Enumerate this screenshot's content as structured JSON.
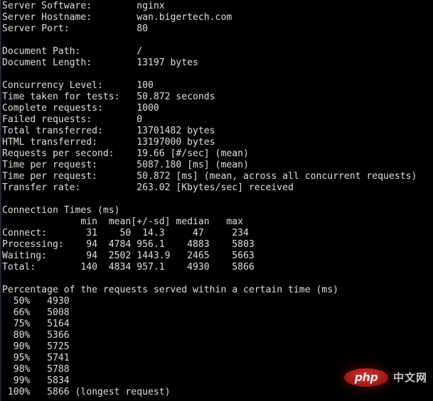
{
  "terminal": {
    "theme": {
      "background": "#000000",
      "foreground": "#d4d4d4",
      "border": "#1e2835"
    },
    "columns": 76,
    "rows": 35
  },
  "report": {
    "server": {
      "software_label": "Server Software:",
      "software_value": "nginx",
      "hostname_label": "Server Hostname:",
      "hostname_value": "wan.bigertech.com",
      "port_label": "Server Port:",
      "port_value": "80"
    },
    "document": {
      "path_label": "Document Path:",
      "path_value": "/",
      "length_label": "Document Length:",
      "length_value": "13197 bytes"
    },
    "summary": [
      {
        "label": "Concurrency Level:",
        "value": "100"
      },
      {
        "label": "Time taken for tests:",
        "value": "50.872 seconds"
      },
      {
        "label": "Complete requests:",
        "value": "1000"
      },
      {
        "label": "Failed requests:",
        "value": "0"
      },
      {
        "label": "Total transferred:",
        "value": "13701482 bytes"
      },
      {
        "label": "HTML transferred:",
        "value": "13197000 bytes"
      },
      {
        "label": "Requests per second:",
        "value": "19.66 [#/sec] (mean)"
      },
      {
        "label": "Time per request:",
        "value": "5087.180 [ms] (mean)"
      },
      {
        "label": "Time per request:",
        "value": "50.872 [ms] (mean, across all concurrent requests)"
      },
      {
        "label": "Transfer rate:",
        "value": "263.02 [Kbytes/sec] received"
      }
    ],
    "connection_times": {
      "heading": "Connection Times (ms)",
      "columns": [
        "min",
        "mean[+/-sd]",
        "median",
        "max"
      ],
      "rows": [
        {
          "label": "Connect:",
          "min": "31",
          "mean": "50",
          "sd": "14.3",
          "median": "47",
          "max": "234"
        },
        {
          "label": "Processing:",
          "min": "94",
          "mean": "4784",
          "sd": "956.1",
          "median": "4883",
          "max": "5803"
        },
        {
          "label": "Waiting:",
          "min": "94",
          "mean": "2502",
          "sd": "1443.9",
          "median": "2465",
          "max": "5663"
        },
        {
          "label": "Total:",
          "min": "140",
          "mean": "4834",
          "sd": "957.1",
          "median": "4930",
          "max": "5866"
        }
      ]
    },
    "percentiles": {
      "heading": "Percentage of the requests served within a certain time (ms)",
      "rows": [
        {
          "percent": "50%",
          "value": "4930",
          "note": ""
        },
        {
          "percent": "66%",
          "value": "5008",
          "note": ""
        },
        {
          "percent": "75%",
          "value": "5164",
          "note": ""
        },
        {
          "percent": "80%",
          "value": "5366",
          "note": ""
        },
        {
          "percent": "90%",
          "value": "5725",
          "note": ""
        },
        {
          "percent": "95%",
          "value": "5741",
          "note": ""
        },
        {
          "percent": "98%",
          "value": "5788",
          "note": ""
        },
        {
          "percent": "99%",
          "value": "5834",
          "note": ""
        },
        {
          "percent": "100%",
          "value": "5866",
          "note": "(longest request)"
        }
      ]
    }
  },
  "watermark": {
    "logo_text": "php",
    "site_text": "中文网",
    "accent_color": "#c1201d"
  },
  "lines": [
    "Server Software:        nginx",
    "Server Hostname:        wan.bigertech.com",
    "Server Port:            80",
    "",
    "Document Path:          /",
    "Document Length:        13197 bytes",
    "",
    "Concurrency Level:      100",
    "Time taken for tests:   50.872 seconds",
    "Complete requests:      1000",
    "Failed requests:        0",
    "Total transferred:      13701482 bytes",
    "HTML transferred:       13197000 bytes",
    "Requests per second:    19.66 [#/sec] (mean)",
    "Time per request:       5087.180 [ms] (mean)",
    "Time per request:       50.872 [ms] (mean, across all concurrent requests)",
    "Transfer rate:          263.02 [Kbytes/sec] received",
    "",
    "Connection Times (ms)",
    "              min  mean[+/-sd] median   max",
    "Connect:       31    50  14.3     47     234",
    "Processing:    94  4784 956.1    4883    5803",
    "Waiting:       94  2502 1443.9   2465    5663",
    "Total:        140  4834 957.1    4930    5866",
    "",
    "Percentage of the requests served within a certain time (ms)",
    "  50%   4930",
    "  66%   5008",
    "  75%   5164",
    "  80%   5366",
    "  90%   5725",
    "  95%   5741",
    "  98%   5788",
    "  99%   5834",
    " 100%   5866 (longest request)"
  ]
}
